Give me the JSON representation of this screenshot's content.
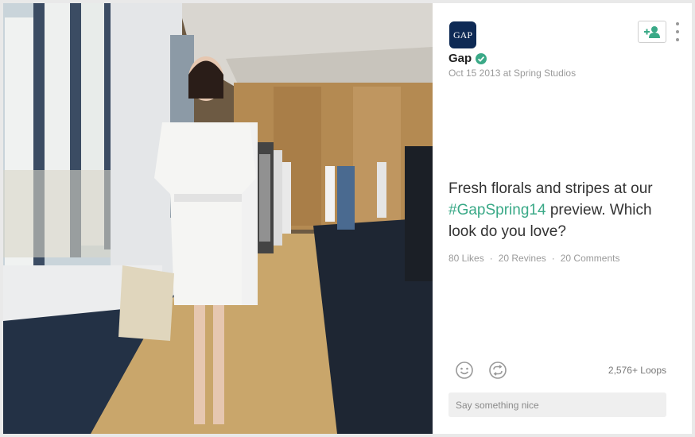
{
  "post": {
    "brand_logo_text": "GAP",
    "author": "Gap",
    "date_location": "Oct 15 2013 at Spring Studios",
    "caption_pre": "Fresh florals and stripes at our ",
    "caption_tag": "#GapSpring14",
    "caption_post": " preview. Which look do you love?",
    "likes": "80 Likes",
    "revines": "20 Revines",
    "comments": "20 Comments",
    "stats_separator": "·",
    "loops": "2,576+ Loops"
  },
  "comment_box": {
    "placeholder": "Say something nice"
  },
  "colors": {
    "accent": "#3aa987",
    "logo_bg": "#0e2a55",
    "verified": "#3aa987"
  },
  "icons": [
    "follow-user-icon",
    "more-dots-icon",
    "verified-badge-icon",
    "smiley-icon",
    "revine-icon"
  ]
}
